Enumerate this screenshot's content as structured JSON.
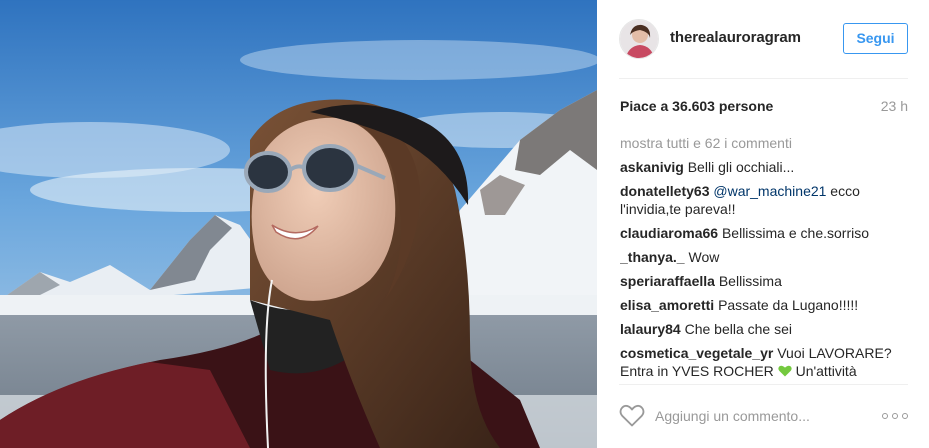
{
  "post": {
    "username": "therealauroragram",
    "follow_label": "Segui",
    "likes_text": "Piace a 36.603 persone",
    "time_ago": "23 h",
    "view_all_comments": "mostra tutti e 62 i commenti",
    "comments": [
      {
        "user": "askanivig",
        "text": "Belli gli occhiali..."
      },
      {
        "user": "donatellety63",
        "mention": "@war_machine21",
        "text": " ecco l'invidia,te pareva!!"
      },
      {
        "user": "claudiaroma66",
        "text": "Bellissima e che.sorriso"
      },
      {
        "user": "_thanya._",
        "text": "Wow"
      },
      {
        "user": "speriaraffaella",
        "text": "Bellissima"
      },
      {
        "user": "elisa_amoretti",
        "text": "Passate da Lugano!!!!!"
      },
      {
        "user": "lalaury84",
        "text": "Che bella che sei"
      },
      {
        "user": "cosmetica_vegetale_yr",
        "text": "Vuoi LAVORARE? Entra in YVES ROCHER",
        "text_after_icon": " Un'attività"
      }
    ],
    "add_comment_placeholder": "Aggiungi un commento...",
    "icons": {
      "like": "heart-outline-icon",
      "more": "more-options-icon",
      "emoji": "green-heart-icon"
    }
  },
  "colors": {
    "accent": "#3897f0",
    "mention": "#003569",
    "muted": "#999999",
    "text": "#262626",
    "emoji_green": "#74c93f"
  }
}
